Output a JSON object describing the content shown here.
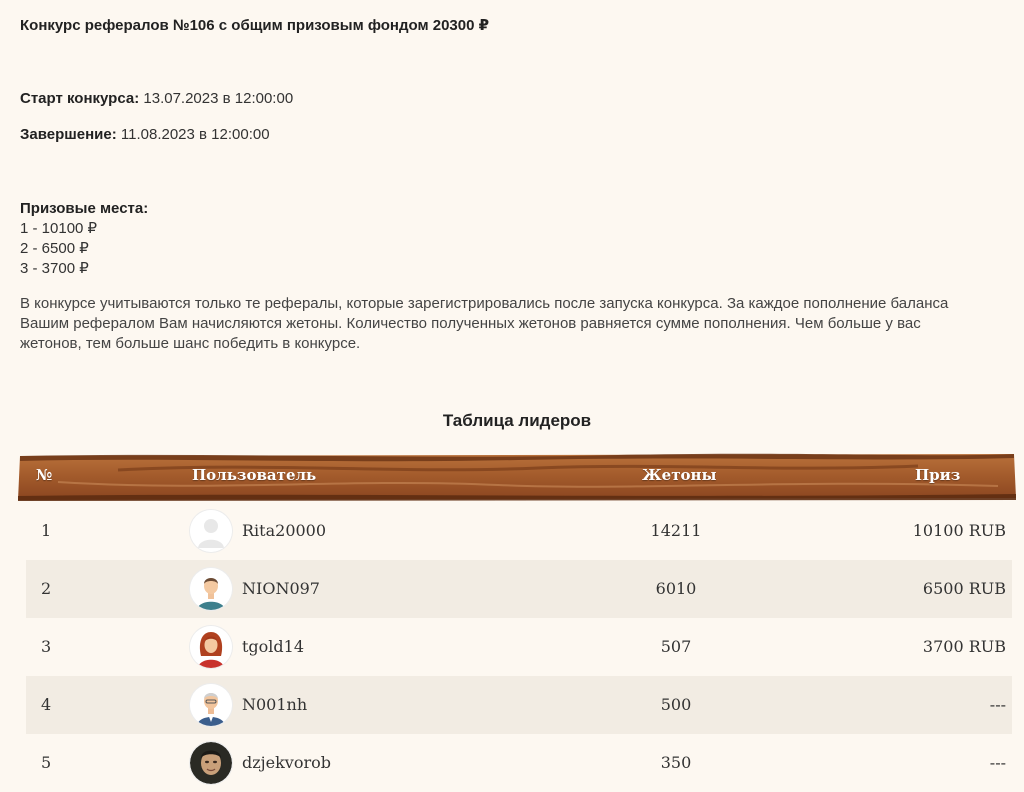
{
  "contest": {
    "title": "Конкурс рефералов №106 с общим призовым фондом 20300 ₽",
    "start_label": "Старт конкурса:",
    "start_value": "13.07.2023 в 12:00:00",
    "end_label": "Завершение:",
    "end_value": "11.08.2023 в 12:00:00",
    "prizes_heading": "Призовые места:",
    "prizes": [
      "1 - 10100 ₽",
      "2 - 6500 ₽",
      "3 - 3700 ₽"
    ],
    "description": "В конкурсе учитываются только те рефералы, которые зарегистрировались после запуска конкурса. За каждое пополнение баланса Вашим рефералом Вам начисляются жетоны. Количество полученных жетонов равняется сумме пополнения. Чем больше у вас жетонов, тем больше шанс победить в конкурсе."
  },
  "leaderboard": {
    "title": "Таблица лидеров",
    "columns": {
      "num": "№",
      "user": "Пользователь",
      "tokens": "Жетоны",
      "prize": "Приз"
    },
    "rows": [
      {
        "num": "1",
        "avatar": "default-avatar",
        "user": "Rita20000",
        "tokens": "14211",
        "prize": "10100 RUB"
      },
      {
        "num": "2",
        "avatar": "man-avatar",
        "user": "NION097",
        "tokens": "6010",
        "prize": "6500 RUB"
      },
      {
        "num": "3",
        "avatar": "woman-avatar",
        "user": "tgold14",
        "tokens": "507",
        "prize": "3700 RUB"
      },
      {
        "num": "4",
        "avatar": "old-man-avatar",
        "user": "N001nh",
        "tokens": "500",
        "prize": "---"
      },
      {
        "num": "5",
        "avatar": "photo-avatar",
        "user": "dzjekvorob",
        "tokens": "350",
        "prize": "---"
      }
    ]
  },
  "colors": {
    "background": "#fdf8f1",
    "header_wood": "#a0582a",
    "row_alt": "#f2ece3"
  }
}
